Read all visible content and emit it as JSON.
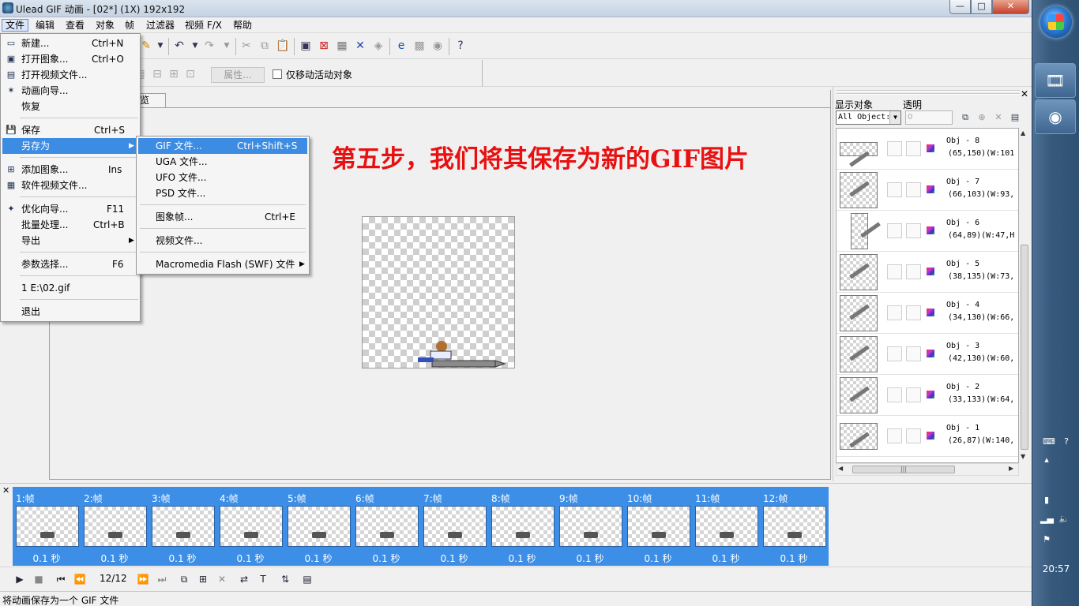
{
  "window": {
    "title": "Ulead GIF 动画 - [02*] (1X) 192x192",
    "min": "—",
    "max": "□",
    "close": "✕"
  },
  "menubar": [
    "文件",
    "编辑",
    "查看",
    "对象",
    "帧",
    "过滤器",
    "视频 F/X",
    "帮助"
  ],
  "toolbar2": {
    "props_label": "属性...",
    "only_move_label": "仅移动活动对象"
  },
  "doc_tab": "览",
  "caption": "第五步，我们将其保存为新的GIF图片",
  "file_menu": [
    {
      "icon": "new-icon",
      "label": "新建...",
      "shortcut": "Ctrl+N"
    },
    {
      "icon": "open-image-icon",
      "label": "打开图象...",
      "shortcut": "Ctrl+O"
    },
    {
      "icon": "open-video-icon",
      "label": "打开视频文件...",
      "shortcut": ""
    },
    {
      "icon": "animation-wizard-icon",
      "label": "动画向导...",
      "shortcut": ""
    },
    {
      "icon": "",
      "label": "恢复",
      "shortcut": ""
    },
    {
      "icon": "save-icon",
      "label": "保存",
      "shortcut": "Ctrl+S"
    },
    {
      "icon": "",
      "label": "另存为",
      "shortcut": ""
    },
    {
      "icon": "add-image-icon",
      "label": "添加图象...",
      "shortcut": "Ins"
    },
    {
      "icon": "add-video-icon",
      "label": "软件视频文件...",
      "shortcut": ""
    },
    {
      "icon": "optimize-wizard-icon",
      "label": "优化向导...",
      "shortcut": "F11"
    },
    {
      "icon": "",
      "label": "批量处理...",
      "shortcut": "Ctrl+B"
    },
    {
      "icon": "",
      "label": "导出",
      "shortcut": ""
    },
    {
      "icon": "",
      "label": "参数选择...",
      "shortcut": "F6"
    },
    {
      "icon": "",
      "label": "1 E:\\02.gif",
      "shortcut": ""
    },
    {
      "icon": "",
      "label": "退出",
      "shortcut": ""
    }
  ],
  "saveas_menu": [
    {
      "label": "GIF 文件...",
      "shortcut": "Ctrl+Shift+S"
    },
    {
      "label": "UGA 文件...",
      "shortcut": ""
    },
    {
      "label": "UFO 文件...",
      "shortcut": ""
    },
    {
      "label": "PSD 文件...",
      "shortcut": ""
    },
    {
      "label": "图象帧...",
      "shortcut": "Ctrl+E"
    },
    {
      "label": "视频文件...",
      "shortcut": ""
    },
    {
      "label": "Macromedia Flash (SWF) 文件",
      "shortcut": ""
    }
  ],
  "object_panel": {
    "show_label": "显示对象",
    "alpha_label": "透明",
    "show_value": "All Object:",
    "alpha_value": "0",
    "objects": [
      {
        "name": "Obj - 8",
        "pos": "(65,150)(W:101"
      },
      {
        "name": "Obj - 7",
        "pos": "(66,103)(W:93,"
      },
      {
        "name": "Obj - 6",
        "pos": "(64,89)(W:47,H"
      },
      {
        "name": "Obj - 5",
        "pos": "(38,135)(W:73,"
      },
      {
        "name": "Obj - 4",
        "pos": "(34,130)(W:66,"
      },
      {
        "name": "Obj - 3",
        "pos": "(42,130)(W:60,"
      },
      {
        "name": "Obj - 2",
        "pos": "(33,133)(W:64,"
      },
      {
        "name": "Obj - 1",
        "pos": "(26,87)(W:140,"
      }
    ]
  },
  "frames": [
    {
      "label": "1:帧",
      "delay": "0.1 秒"
    },
    {
      "label": "2:帧",
      "delay": "0.1 秒"
    },
    {
      "label": "3:帧",
      "delay": "0.1 秒"
    },
    {
      "label": "4:帧",
      "delay": "0.1 秒"
    },
    {
      "label": "5:帧",
      "delay": "0.1 秒"
    },
    {
      "label": "6:帧",
      "delay": "0.1 秒"
    },
    {
      "label": "7:帧",
      "delay": "0.1 秒"
    },
    {
      "label": "8:帧",
      "delay": "0.1 秒"
    },
    {
      "label": "9:帧",
      "delay": "0.1 秒"
    },
    {
      "label": "10:帧",
      "delay": "0.1 秒"
    },
    {
      "label": "11:帧",
      "delay": "0.1 秒"
    },
    {
      "label": "12:帧",
      "delay": "0.1 秒"
    }
  ],
  "frame_counter": "12/12",
  "status": "将动画保存为一个 GIF 文件",
  "clock": "20:57",
  "colors": {
    "caption_red": "#e81010",
    "frame_strip_blue": "#3d8ee6",
    "menu_highlight": "#3c8ce4"
  }
}
